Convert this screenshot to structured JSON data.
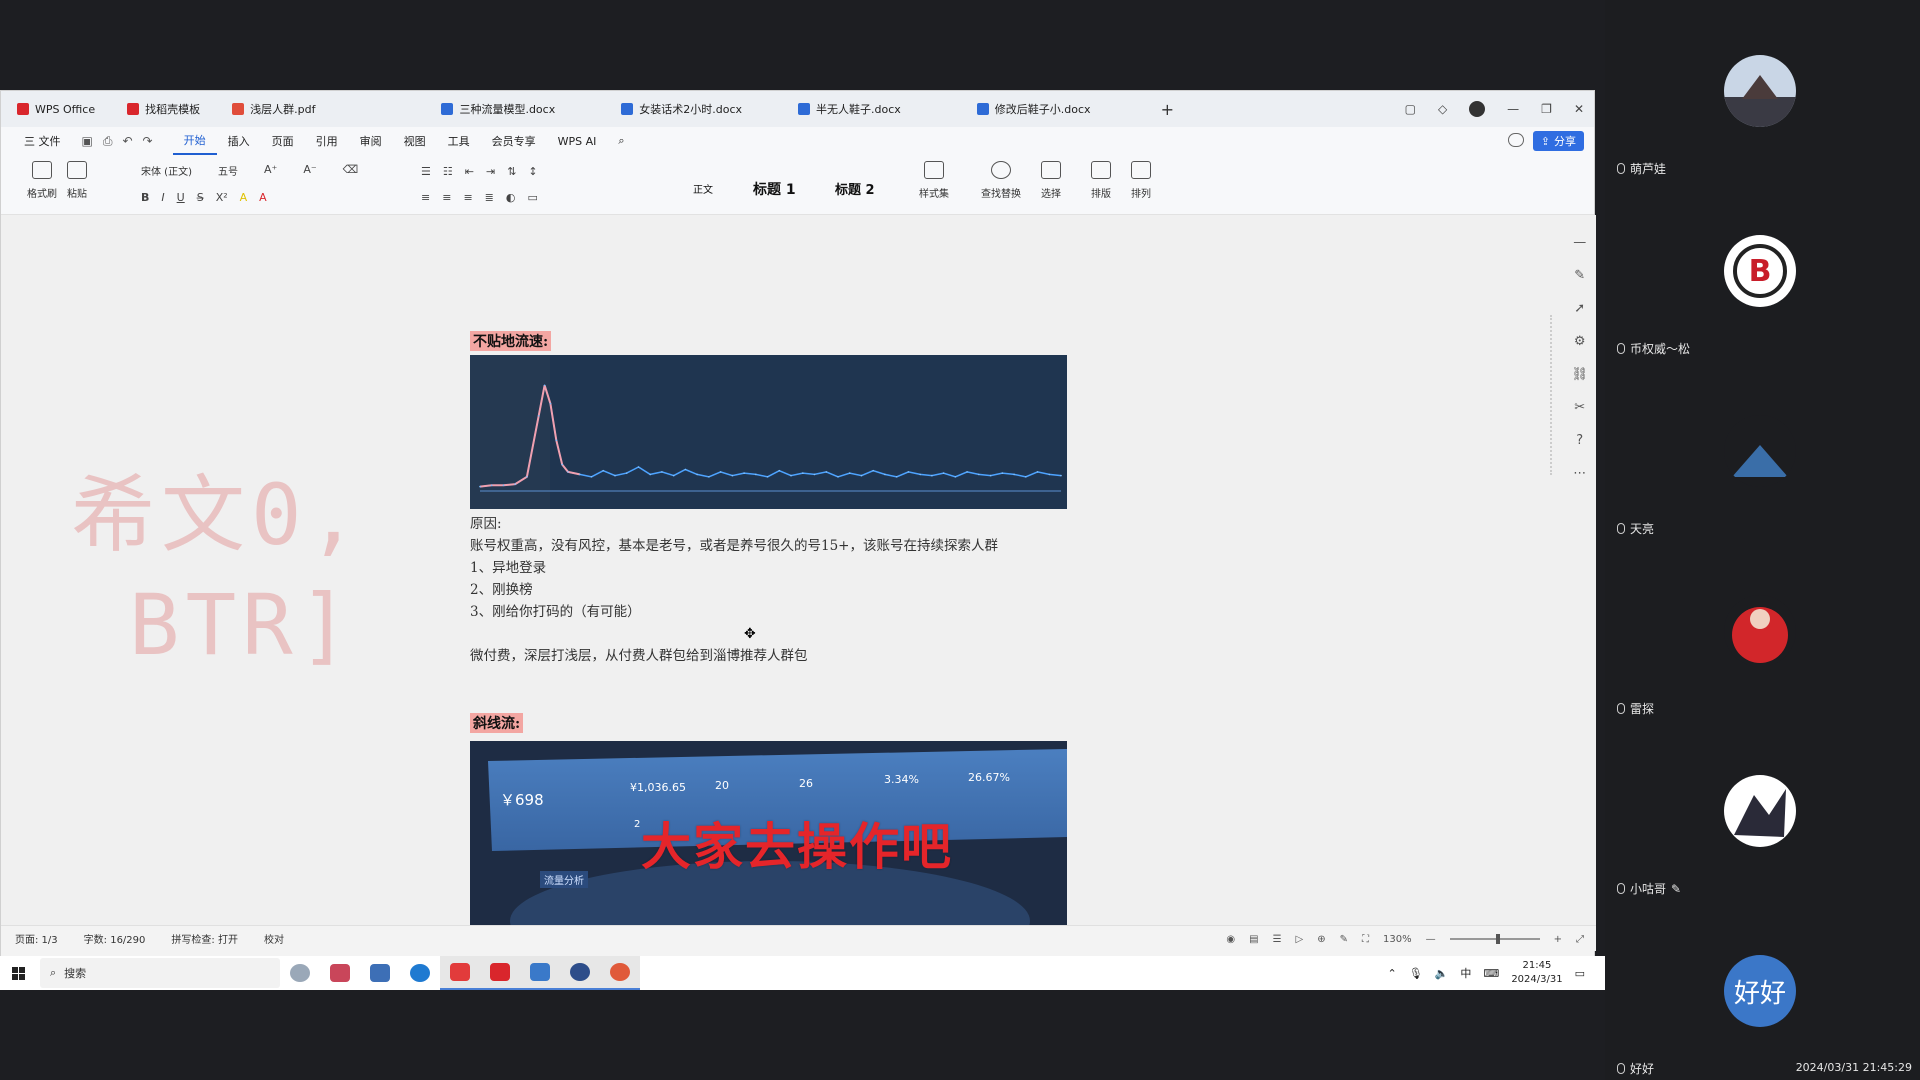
{
  "tabs": [
    {
      "label": "WPS Office",
      "kind": "wps"
    },
    {
      "label": "找稻壳模板",
      "kind": "tpl"
    },
    {
      "label": "浅层人群.pdf",
      "kind": "pdf"
    },
    {
      "label": "三种流量模型.docx",
      "kind": "doc"
    },
    {
      "label": "女装话术2小时.docx",
      "kind": "doc"
    },
    {
      "label": "半无人鞋子.docx",
      "kind": "doc"
    },
    {
      "label": "修改后鞋子小.docx",
      "kind": "doc"
    }
  ],
  "menu": {
    "file": "三 文件",
    "items": [
      "开始",
      "插入",
      "页面",
      "引用",
      "审阅",
      "视图",
      "工具",
      "会员专享"
    ],
    "active": "开始",
    "wps_ai": "WPS AI",
    "share": "分享"
  },
  "ribbon": {
    "format_painter": "格式刷",
    "paste": "粘贴",
    "font_name": "宋体 (正文)",
    "font_size": "五号",
    "style_normal": "正文",
    "heading1": "标题 1",
    "heading2": "标题 2",
    "style_set": "样式集",
    "find_replace": "查找替换",
    "select": "选择",
    "layout": "排版",
    "arrange": "排列"
  },
  "watermark": {
    "line1": "希文0,",
    "line2": "BTR]"
  },
  "document": {
    "section1_title": "不贴地流速:",
    "reason_label": "原因:",
    "reason_text": "账号权重高，没有风控，基本是老号，或者是养号很久的号15+，该账号在持续探索人群",
    "items": [
      "1、异地登录",
      "2、刚换榜",
      "3、刚给你打码的（有可能）"
    ],
    "note": "微付费，深层打浅层，从付费人群包给到淄博推荐人群包",
    "section2_title": "斜线流:",
    "overlay_text": "大家去操作吧",
    "dashboard": {
      "amount": "￥698",
      "metrics": [
        "¥1,036.65",
        "20",
        "26",
        "3.34%",
        "26.67%"
      ],
      "extra": "2",
      "tabs": [
        "流量分析"
      ]
    }
  },
  "chart_data": {
    "type": "line",
    "title": "",
    "x": [
      0,
      4,
      8,
      12,
      16,
      20,
      22,
      24,
      26,
      28,
      30,
      34,
      38,
      42,
      46,
      50,
      54,
      58,
      62,
      66,
      70,
      74,
      78,
      82,
      86,
      90,
      94,
      98,
      102,
      106,
      110,
      114,
      118,
      122,
      126,
      130,
      134,
      138,
      142,
      146,
      150,
      154,
      158,
      162,
      166,
      170,
      174,
      178,
      182,
      186,
      190,
      194,
      198
    ],
    "values": [
      2,
      3,
      3,
      4,
      10,
      60,
      85,
      70,
      40,
      20,
      14,
      12,
      10,
      15,
      11,
      13,
      18,
      12,
      14,
      11,
      16,
      12,
      10,
      14,
      11,
      13,
      12,
      10,
      15,
      11,
      13,
      12,
      14,
      10,
      13,
      11,
      15,
      12,
      10,
      14,
      12,
      11,
      13,
      10,
      14,
      12,
      11,
      13,
      12,
      10,
      14,
      12,
      11
    ],
    "ylim": [
      0,
      100
    ],
    "grid": false
  },
  "statusbar": {
    "page": "页面: 1/3",
    "words": "字数: 16/290",
    "spell": "拼写检查: 打开",
    "proof": "校对",
    "zoom": "130%"
  },
  "taskbar": {
    "search": "搜索",
    "time": "21:45",
    "date": "2024/3/31",
    "ime": "中"
  },
  "participants": [
    {
      "name": "萌芦娃",
      "avatar_color": "#c9d6e6"
    },
    {
      "name": "币权威～松",
      "avatar_color": "#ffffff",
      "avatar_text": "B"
    },
    {
      "name": "天亮",
      "avatar_color": "#1c1d20"
    },
    {
      "name": "雷探",
      "avatar_color": "#d2262a"
    },
    {
      "name": "小咕哥",
      "avatar_color": "#ffffff"
    },
    {
      "name": "好好",
      "avatar_color": "#3b77c8",
      "avatar_text": "好好"
    }
  ],
  "timestamp": "2024/03/31 21:45:29"
}
